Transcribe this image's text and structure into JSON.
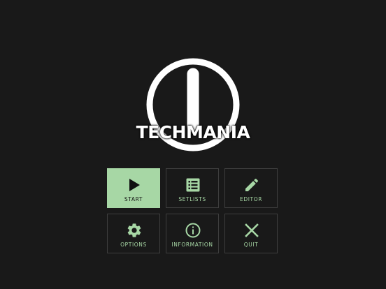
{
  "logo": {
    "text": "TECHMANIA",
    "icon": "power-logo-icon"
  },
  "menu": {
    "selected": "start",
    "buttons": [
      {
        "id": "start",
        "label": "START",
        "icon": "play-icon"
      },
      {
        "id": "setlists",
        "label": "SETLISTS",
        "icon": "list-icon"
      },
      {
        "id": "editor",
        "label": "EDITOR",
        "icon": "pencil-icon"
      },
      {
        "id": "options",
        "label": "OPTIONS",
        "icon": "gear-icon"
      },
      {
        "id": "information",
        "label": "INFORMATION",
        "icon": "info-icon"
      },
      {
        "id": "quit",
        "label": "QUIT",
        "icon": "close-icon"
      }
    ]
  },
  "colors": {
    "background": "#191919",
    "accent": "#a7d7a5",
    "button_border": "#3e3e3e",
    "selected_label": "#111111"
  }
}
